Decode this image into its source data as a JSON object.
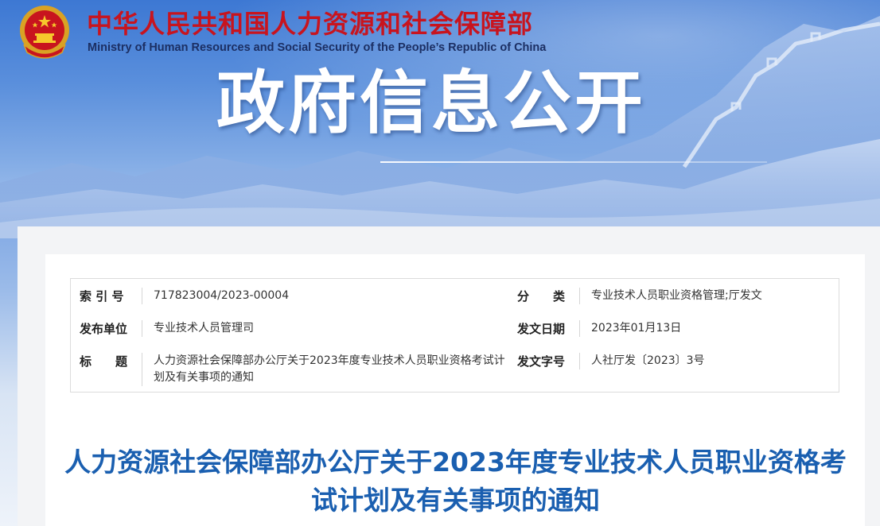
{
  "header": {
    "ministry_name_cn": "中华人民共和国人力资源和社会保障部",
    "ministry_name_en": "Ministry of Human Resources and Social Security of the People’s Republic of China",
    "banner_title": "政府信息公开",
    "emblem_icon": "national-emblem-icon"
  },
  "metadata": {
    "index_label": "索 引 号",
    "index_value": "717823004/2023-00004",
    "category_label": "分　　类",
    "category_value": "专业技术人员职业资格管理;厅发文",
    "publisher_label": "发布单位",
    "publisher_value": "专业技术人员管理司",
    "date_label": "发文日期",
    "date_value": "2023年01月13日",
    "title_label": "标　　题",
    "title_value": "人力资源社会保障部办公厅关于2023年度专业技术人员职业资格考试计划及有关事项的通知",
    "doc_number_label": "发文字号",
    "doc_number_value": "人社厅发〔2023〕3号"
  },
  "document": {
    "title": "人力资源社会保障部办公厅关于2023年度专业技术人员职业资格考试计划及有关事项的通知"
  },
  "colors": {
    "ministry_red": "#c8141e",
    "title_blue": "#1a5fb0",
    "banner_blue": "#4a7fd6"
  }
}
